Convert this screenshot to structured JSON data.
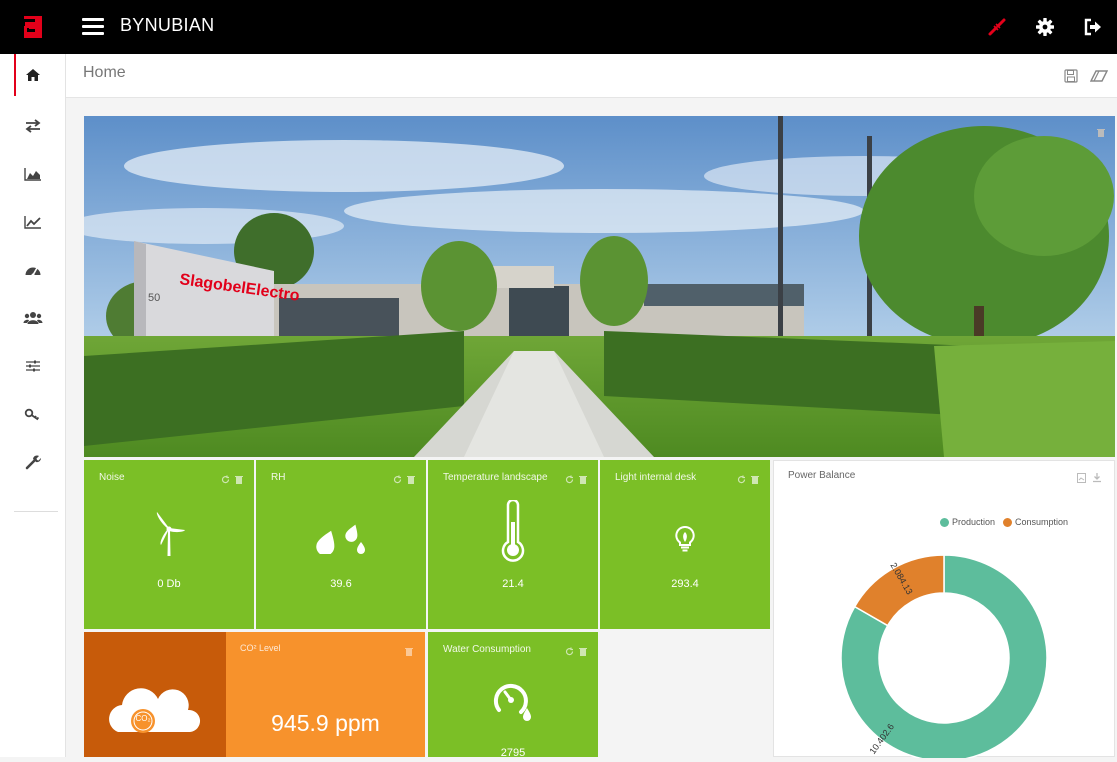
{
  "app": {
    "brand": "BYNUBIAN",
    "colors": {
      "topbar": "#000000",
      "accent": "#e2001a",
      "tile_green": "#7bbf26",
      "co2_dark": "#c75b0a",
      "co2_light": "#f7922c",
      "production": "#5dbd9c",
      "consumption": "#e0812c"
    }
  },
  "topbar": {
    "icons": [
      "connection-broken-icon",
      "gear-icon",
      "sign-out-icon"
    ]
  },
  "sidebar": {
    "items": [
      {
        "name": "home",
        "icon": "home-icon",
        "active": true
      },
      {
        "name": "transfers",
        "icon": "exchange-icon"
      },
      {
        "name": "area-chart",
        "icon": "area-chart-icon"
      },
      {
        "name": "line-chart",
        "icon": "line-chart-icon"
      },
      {
        "name": "dashboard",
        "icon": "dashboard-icon"
      },
      {
        "name": "users",
        "icon": "users-icon"
      },
      {
        "name": "settings-sliders",
        "icon": "sliders-icon"
      },
      {
        "name": "keys",
        "icon": "key-icon"
      },
      {
        "name": "tools",
        "icon": "wrench-icon"
      }
    ]
  },
  "breadcrumb": {
    "title": "Home"
  },
  "tiles": [
    {
      "title": "Noise",
      "value": "0 Db",
      "icon": "wind-turbine-icon"
    },
    {
      "title": "RH",
      "value": "39.6",
      "icon": "drops-icon"
    },
    {
      "title": "Temperature landscape",
      "value": "21.4",
      "icon": "thermometer-icon"
    },
    {
      "title": "Light internal desk",
      "value": "293.4",
      "icon": "lightbulb-icon"
    },
    {
      "title": "Water Consumption",
      "value": "2795",
      "icon": "water-gauge-icon"
    }
  ],
  "co2": {
    "title": "CO² Level",
    "value": "945.9 ppm",
    "badge": "CO₂",
    "icon": "co2-cloud-icon"
  },
  "power_balance": {
    "title": "Power Balance",
    "legend": [
      "Production",
      "Consumption"
    ]
  },
  "chart_data": {
    "type": "pie",
    "title": "Power Balance",
    "labels": [
      "Production",
      "Consumption"
    ],
    "values": [
      10402.6,
      2084.13
    ],
    "data_labels": [
      "10.402.6",
      "2.084.13"
    ],
    "donut": true,
    "legend": "top-right"
  }
}
